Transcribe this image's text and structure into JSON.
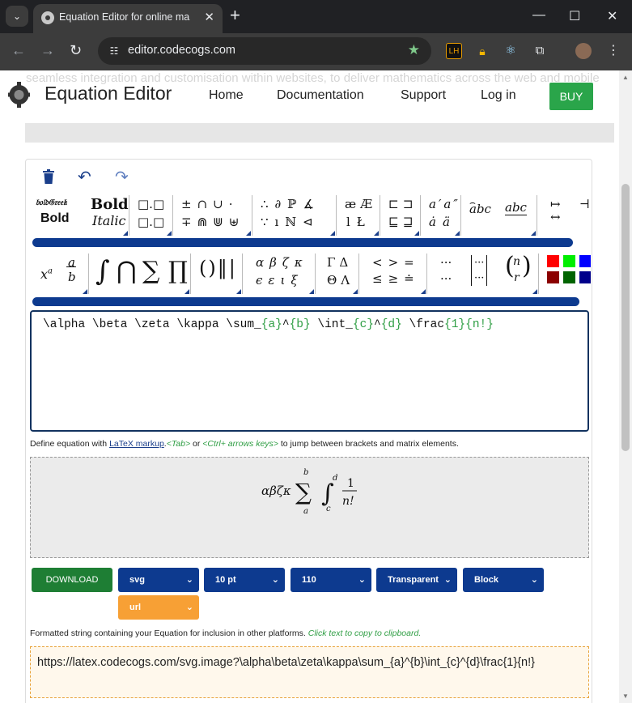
{
  "browser": {
    "tab_title": "Equation Editor for online ma",
    "url": "editor.codecogs.com",
    "new_tab": "+",
    "controls": {
      "minimize": "—",
      "maximize": "☐",
      "close": "✕"
    },
    "ext_lh": "LH"
  },
  "site": {
    "ghost_text": "seamless integration and customisation within websites, to deliver mathematics across the web and mobile",
    "brand": "Equation Editor",
    "menu": [
      "Home",
      "Documentation",
      "Support",
      "Log in"
    ],
    "buy": "BUY"
  },
  "editor": {
    "hint_prefix": "Define equation with ",
    "hint_link": "LaTeX markup",
    "hint_tab": "<Tab>",
    "hint_or": " or ",
    "hint_keys": "<Ctrl+ arrows keys>",
    "hint_suffix": " to jump between brackets and matrix elements.",
    "latex_parts": [
      "\\alpha \\beta \\zeta \\kappa \\sum_",
      "{a}",
      "^",
      "{b}",
      " \\int_",
      "{c}",
      "^",
      "{d}",
      " \\frac",
      "{1}",
      "{n!}"
    ],
    "download": "DOWNLOAD",
    "selects": [
      "svg",
      "10 pt",
      "110",
      "Transparent",
      "Block",
      "url"
    ],
    "copy_hint": "Formatted string containing your Equation for inclusion in other platforms. ",
    "copy_hint_green": "Click text to copy to clipboard.",
    "output_url": "https://latex.codecogs.com/svg.image?\\alpha\\beta\\zeta\\kappa\\sum_{a}^{b}\\int_{c}^{d}\\frac{1}{n!}"
  },
  "colors": {
    "blue": "#0d3a8f",
    "green": "#1e7e34",
    "orange": "#f7a035",
    "buy": "#2aa54a",
    "swatches": [
      "#ff0000",
      "#00ee00",
      "#0000ff",
      "#8b0000",
      "#006400",
      "#00008b"
    ]
  },
  "icons": [
    "trash-icon",
    "undo-icon",
    "redo-icon",
    "star-icon",
    "tune-icon"
  ]
}
